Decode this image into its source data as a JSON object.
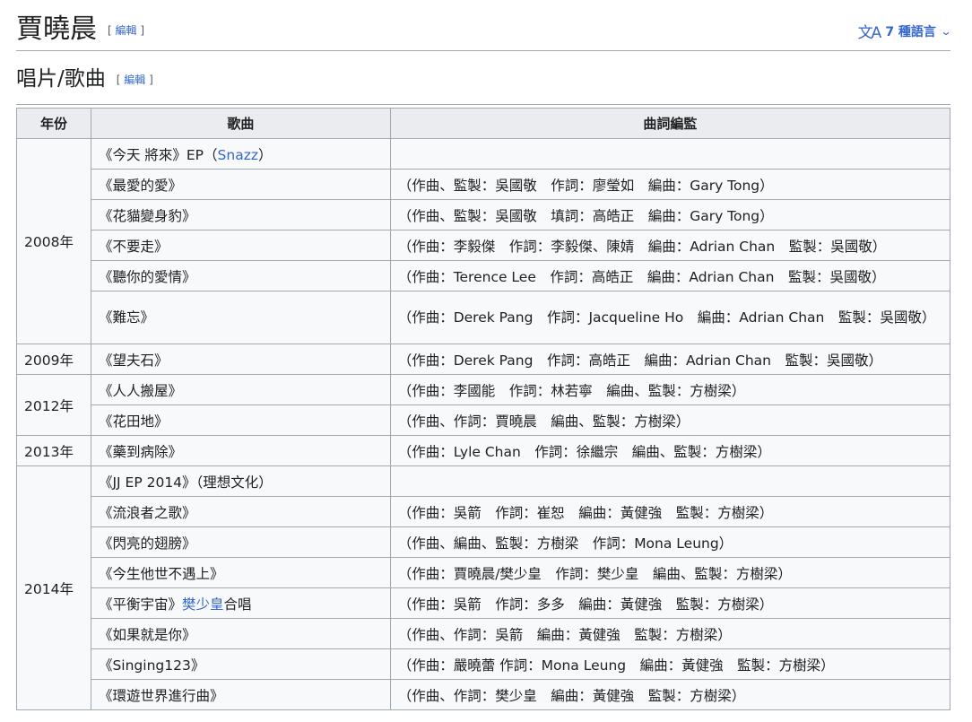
{
  "header": {
    "title": "賈曉晨",
    "edit_open": "[",
    "edit_label": "編輯",
    "edit_close": "]",
    "languages_label": "7 種語言",
    "translate_icon": "translate-icon",
    "chevron_icon": "chevron-down-icon"
  },
  "section": {
    "title": "唱片/歌曲",
    "edit_label": "編輯"
  },
  "table": {
    "headers": [
      "年份",
      "歌曲",
      "曲詞編監"
    ],
    "years": {
      "y2008": "2008年",
      "y2009": "2009年",
      "y2012": "2012年",
      "y2013": "2013年",
      "y2014": "2014年"
    },
    "rows": [
      {
        "song_a": "《今天 將來》EP（",
        "song_link": "Snazz",
        "song_b": "）",
        "credits": ""
      },
      {
        "song": "《最愛的愛》",
        "credits": "（作曲、監製：吳國敬　作詞：廖瑩如　編曲：Gary Tong）"
      },
      {
        "song": "《花貓變身豹》",
        "credits": "（作曲、監製：吳國敬　填詞：高皓正　編曲：Gary Tong）"
      },
      {
        "song": "《不要走》",
        "credits": "（作曲：李毅傑　作詞：李毅傑、陳婧　編曲：Adrian Chan　監製：吳國敬）"
      },
      {
        "song": "《聽你的愛情》",
        "credits": "（作曲：Terence Lee　作詞：高皓正　編曲：Adrian Chan　監製：吳國敬）"
      },
      {
        "song": "《難忘》",
        "credits": "（作曲：Derek Pang　作詞：Jacqueline Ho　編曲：Adrian Chan　監製：吳國敬）"
      },
      {
        "song": "《望夫石》",
        "credits": "（作曲：Derek Pang　作詞：高皓正　編曲：Adrian Chan　監製：吳國敬）"
      },
      {
        "song": "《人人搬屋》",
        "credits": "（作曲：李國能　作詞：林若寧　編曲、監製：方樹梁）"
      },
      {
        "song": "《花田地》",
        "credits": "（作曲、作詞：賈曉晨　編曲、監製：方樹梁）"
      },
      {
        "song": "《藥到病除》",
        "credits": "（作曲：Lyle Chan　作詞：徐繼宗　編曲、監製：方樹梁）"
      },
      {
        "song": "《JJ EP 2014》（理想文化）",
        "credits": ""
      },
      {
        "song": "《流浪者之歌》",
        "credits": "（作曲：吳箭　作詞：崔恕　編曲：黃健強　監製：方樹梁）"
      },
      {
        "song": "《閃亮的翅膀》",
        "credits": "（作曲、編曲、監製：方樹梁　作詞：Mona Leung）"
      },
      {
        "song": "《今生他世不遇上》",
        "credits": "（作曲：賈曉晨/樊少皇　作詞：樊少皇　編曲、監製：方樹梁）"
      },
      {
        "song_a": "《平衡宇宙》",
        "song_link": "樊少皇",
        "song_b": "合唱",
        "credits": "（作曲：吳箭　作詞：多多　編曲：黃健強　監製：方樹梁）"
      },
      {
        "song": "《如果就是你》",
        "credits": "（作曲、作詞：吳箭　編曲：黃健強　監製：方樹梁）"
      },
      {
        "song": "《Singing123》",
        "credits": "（作曲：嚴曉蕾 作詞：Mona Leung　編曲：黃健強　監製：方樹梁）"
      },
      {
        "song": "《環遊世界進行曲》",
        "credits": "（作曲、作詞：樊少皇　編曲：黃健強　監製：方樹梁）"
      }
    ]
  },
  "colors": {
    "link": "#3366cc",
    "text": "#202122",
    "border": "#a2a9b1",
    "header_bg": "#eaecf0",
    "cell_bg": "#f8f9fa"
  }
}
